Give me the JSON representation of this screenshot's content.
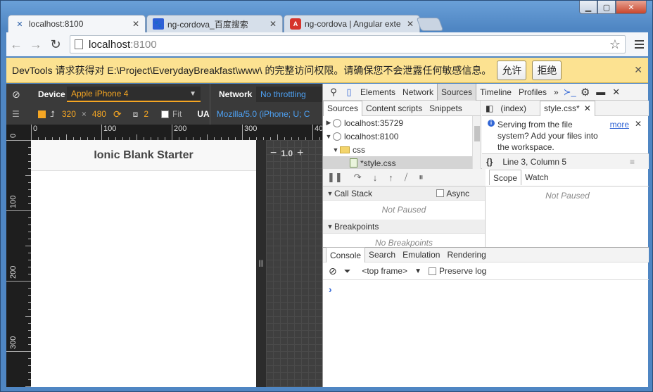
{
  "browser": {
    "tabs": [
      {
        "title": "localhost:8100",
        "icon": "ionic-icon",
        "active": true
      },
      {
        "title": "ng-cordova_百度搜索",
        "icon": "baidu-icon",
        "active": false
      },
      {
        "title": "ng-cordova | Angular exte",
        "icon": "angular-icon",
        "active": false
      }
    ],
    "url_host": "localhost",
    "url_port": ":8100"
  },
  "infobar": {
    "message": "DevTools 请求获得对 E:\\Project\\EverydayBreakfast\\www\\ 的完整访问权限。请确保您不会泄露任何敏感信息。",
    "allow": "允许",
    "deny": "拒绝"
  },
  "emulation": {
    "device_label": "Device",
    "device_value": "Apple iPhone 4",
    "network_label": "Network",
    "network_value": "No throttling",
    "width": "320",
    "times": "×",
    "height": "480",
    "scale": "2",
    "fit": "Fit",
    "ua_label": "UA",
    "ua_value": "Mozilla/5.0 (iPhone; U; C",
    "zoom": "1.0",
    "ruler_top": [
      "0",
      "100",
      "200",
      "300",
      "40"
    ],
    "ruler_left": [
      "0",
      "100",
      "200",
      "300"
    ]
  },
  "app": {
    "header_title": "Ionic Blank Starter"
  },
  "devtools": {
    "tabs": [
      "Elements",
      "Network",
      "Sources",
      "Timeline",
      "Profiles",
      "»"
    ],
    "active_tab": "Sources",
    "nav_tabs": [
      "Sources",
      "Content scripts",
      "Snippets"
    ],
    "tree": [
      {
        "label": "localhost:35729",
        "kind": "origin",
        "expanded": false
      },
      {
        "label": "localhost:8100",
        "kind": "origin",
        "expanded": true
      },
      {
        "label": "css",
        "kind": "folder",
        "expanded": true
      },
      {
        "label": "*style.css",
        "kind": "file",
        "selected": true
      }
    ],
    "editor_tabs": [
      "(index)",
      "style.css*"
    ],
    "notice": "Serving from the file system? Add your files into the workspace.",
    "notice_link": "more",
    "status": "Line 3, Column 5",
    "call_stack": "Call Stack",
    "async": "Async",
    "not_paused": "Not Paused",
    "breakpoints": "Breakpoints",
    "no_breakpoints": "No Breakpoints",
    "scope_tabs": [
      "Scope",
      "Watch"
    ],
    "console_tabs": [
      "Console",
      "Search",
      "Emulation",
      "Rendering"
    ],
    "frame": "<top frame>",
    "preserve_log": "Preserve log",
    "prompt": "›"
  }
}
